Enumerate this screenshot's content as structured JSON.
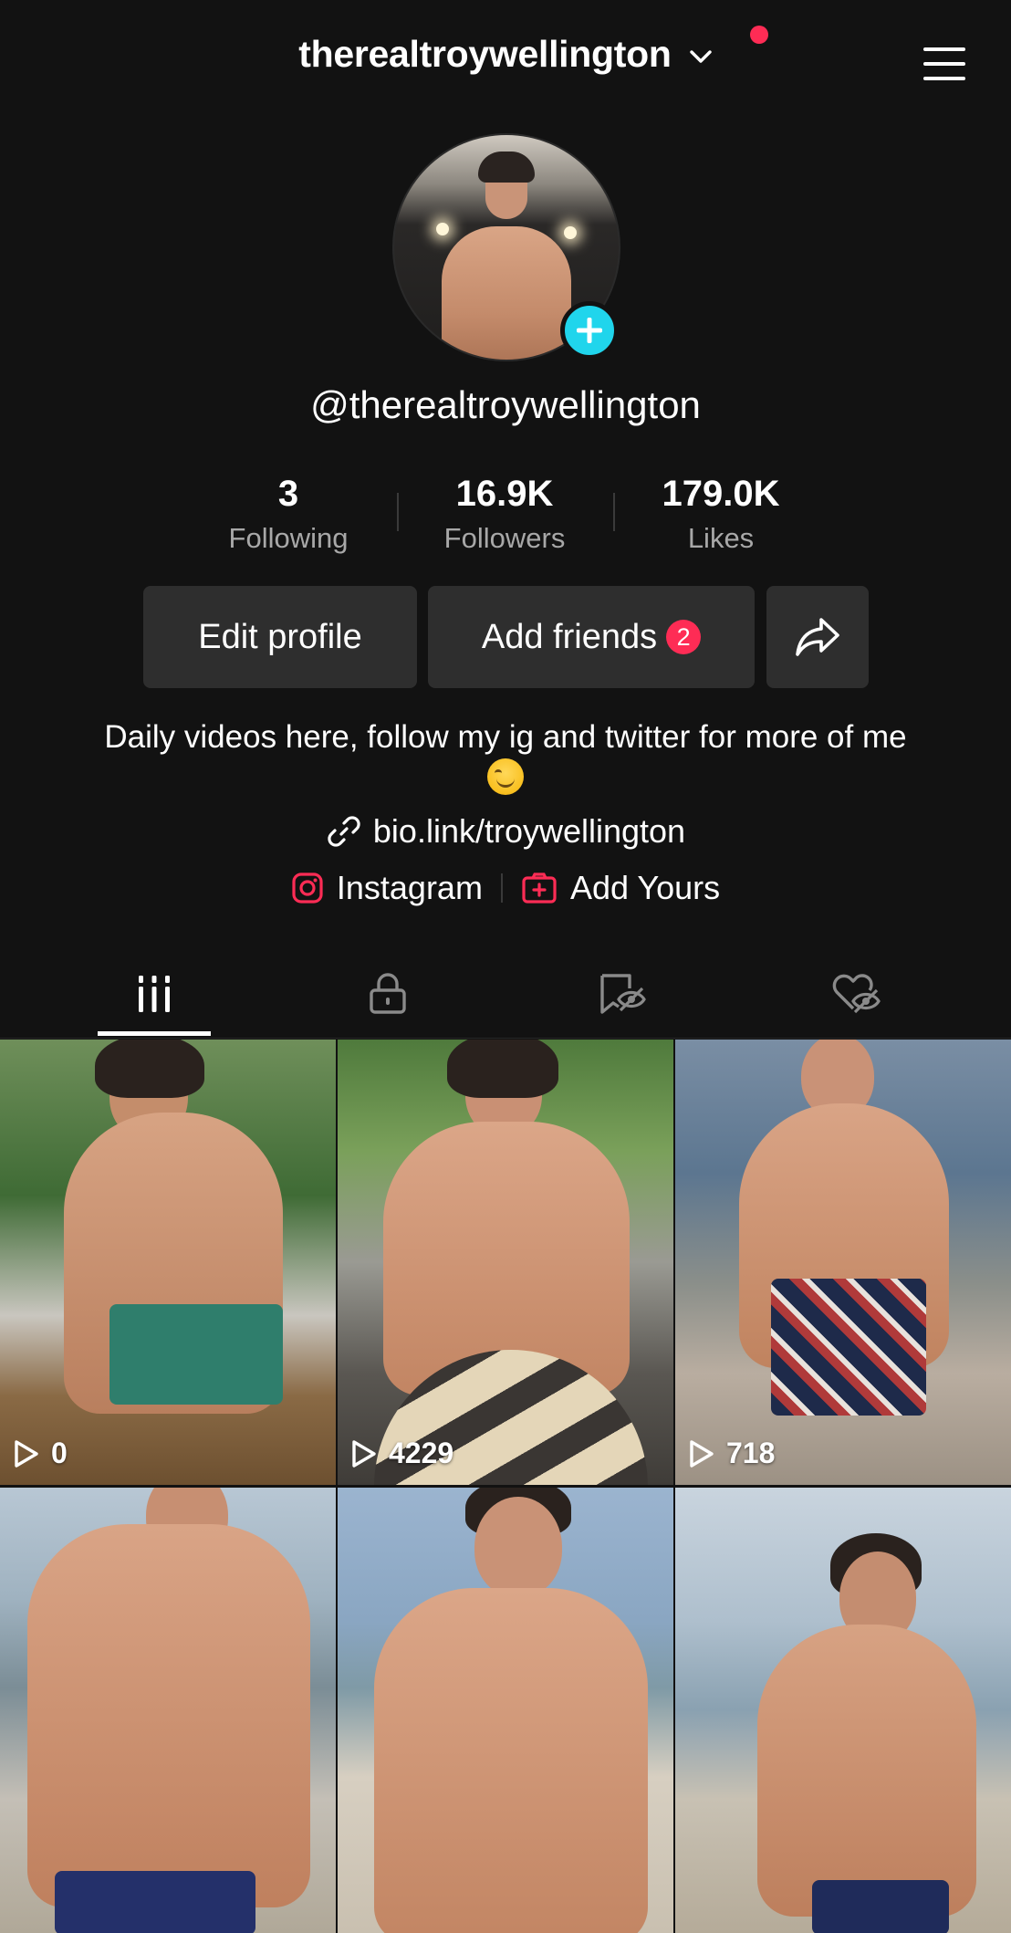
{
  "header": {
    "username": "therealtroywellington"
  },
  "profile": {
    "handle": "@therealtroywellington",
    "stats": [
      {
        "value": "3",
        "label": "Following"
      },
      {
        "value": "16.9K",
        "label": "Followers"
      },
      {
        "value": "179.0K",
        "label": "Likes"
      }
    ],
    "buttons": {
      "edit": "Edit profile",
      "add_friends": "Add friends",
      "add_friends_badge": "2"
    },
    "bio_text": "Daily videos here, follow my ig and twitter for more of me",
    "bio_emoji": "smiling-face-with-smiling-eyes",
    "link": "bio.link/troywellington",
    "social": {
      "instagram": "Instagram",
      "add_yours": "Add Yours"
    }
  },
  "tabs": [
    {
      "icon": "videos-grid-icon",
      "active": true
    },
    {
      "icon": "lock-icon",
      "active": false
    },
    {
      "icon": "favorites-hidden-icon",
      "active": false
    },
    {
      "icon": "liked-hidden-icon",
      "active": false
    }
  ],
  "videos": [
    {
      "views": "0"
    },
    {
      "views": "4229"
    },
    {
      "views": "718"
    },
    {
      "views": ""
    },
    {
      "views": ""
    },
    {
      "views": ""
    }
  ],
  "colors": {
    "background": "#121212",
    "accent_red": "#fe2c55",
    "accent_cyan": "#20d5ec",
    "button_bg": "#2e2e2e"
  }
}
